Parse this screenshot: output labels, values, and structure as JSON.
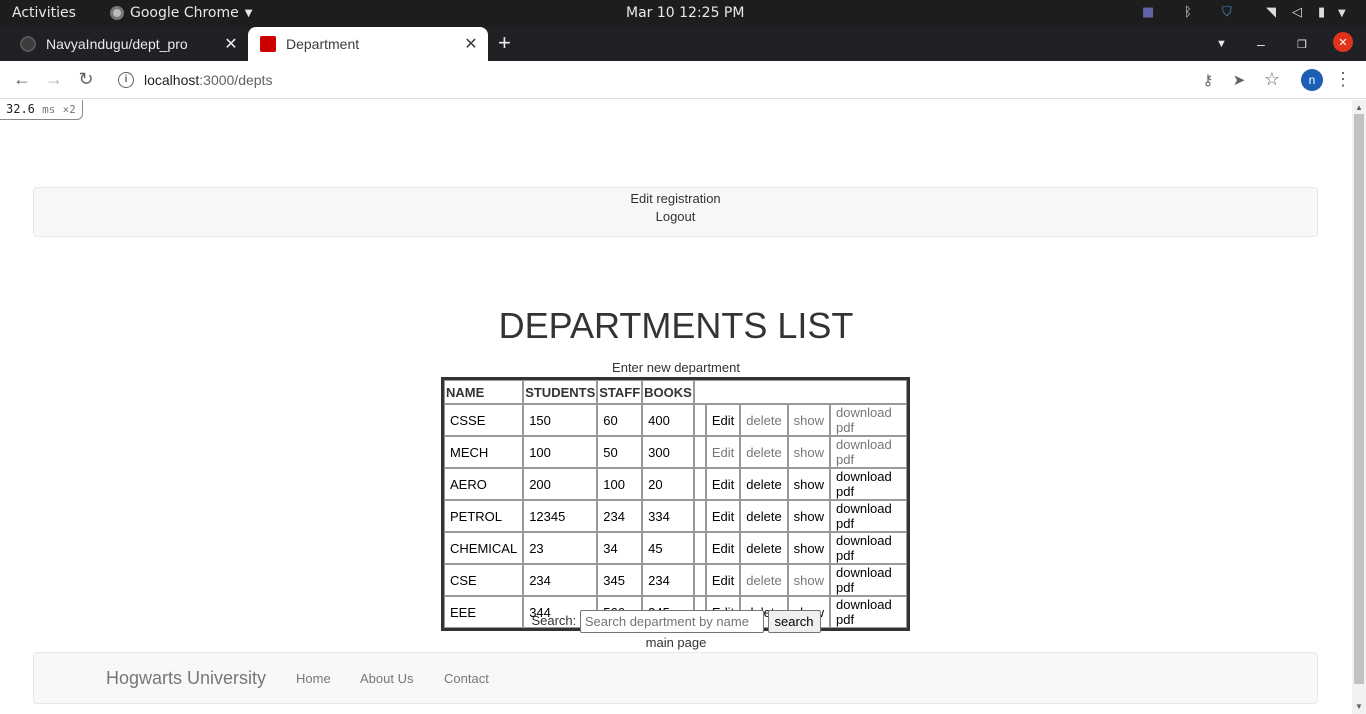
{
  "system": {
    "activities": "Activities",
    "app_name": "Google Chrome",
    "clock": "Mar 10  12:25 PM"
  },
  "browser": {
    "tabs": [
      {
        "title": "NavyaIndugu/dept_pro"
      },
      {
        "title": "Department"
      }
    ],
    "url_host": "localhost",
    "url_path": ":3000/depts",
    "profile_initial": "n"
  },
  "page": {
    "timing_value": "32.6",
    "timing_unit": "ms",
    "timing_count": "×2",
    "nav": {
      "edit_registration": "Edit registration",
      "logout": "Logout"
    },
    "title": "DEPARTMENTS LIST",
    "new_department": "Enter new department",
    "table": {
      "headers": [
        "NAME",
        "STUDENTS",
        "STAFF",
        "BOOKS"
      ],
      "rows": [
        {
          "name": "CSSE",
          "students": "150",
          "staff": "60",
          "books": "400",
          "edit": "Edit",
          "delete": "delete",
          "show": "show",
          "pdf": "download pdf"
        },
        {
          "name": "MECH",
          "students": "100",
          "staff": "50",
          "books": "300",
          "edit": "Edit",
          "delete": "delete",
          "show": "show",
          "pdf": "download pdf"
        },
        {
          "name": "AERO",
          "students": "200",
          "staff": "100",
          "books": "20",
          "edit": "Edit",
          "delete": "delete",
          "show": "show",
          "pdf": "download pdf"
        },
        {
          "name": "PETROL",
          "students": "12345",
          "staff": "234",
          "books": "334",
          "edit": "Edit",
          "delete": "delete",
          "show": "show",
          "pdf": "download pdf"
        },
        {
          "name": "CHEMICAL",
          "students": "23",
          "staff": "34",
          "books": "45",
          "edit": "Edit",
          "delete": "delete",
          "show": "show",
          "pdf": "download pdf"
        },
        {
          "name": "CSE",
          "students": "234",
          "staff": "345",
          "books": "234",
          "edit": "Edit",
          "delete": "delete",
          "show": "show",
          "pdf": "download pdf"
        },
        {
          "name": "EEE",
          "students": "344",
          "staff": "566",
          "books": "345",
          "edit": "Edit",
          "delete": "delete",
          "show": "show",
          "pdf": "download pdf"
        }
      ]
    },
    "search": {
      "label": "Search:",
      "placeholder": "Search department by name",
      "button": "search"
    },
    "main_page": "main page",
    "footer": {
      "brand": "Hogwarts University",
      "links": [
        "Home",
        "About Us",
        "Contact"
      ]
    }
  },
  "colors": {
    "muted_link": "#777777",
    "active_link": "#000000"
  }
}
